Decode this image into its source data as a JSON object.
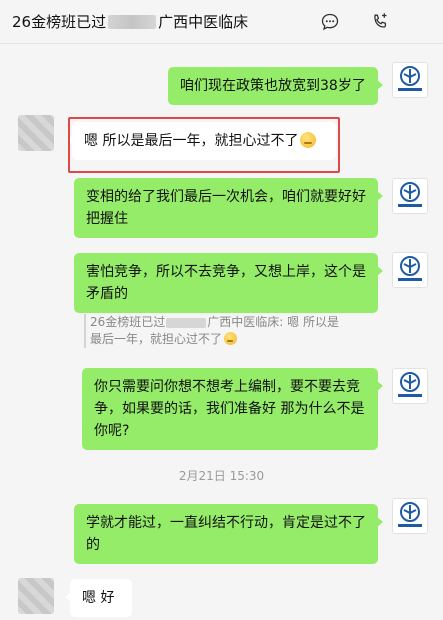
{
  "window": {
    "title_part1": "26金榜班已过",
    "title_part2": "广西中医临床"
  },
  "toolbar": {
    "more_icon": "more-dots-icon",
    "call_icon": "phone-call-icon"
  },
  "logo_text": "中星教育",
  "messages": [
    {
      "side": "out",
      "text": "咱们现在政策也放宽到38岁了"
    },
    {
      "side": "in",
      "text": "嗯    所以是最后一年，就担心过不了",
      "emoji": "worried-face-emoji"
    },
    {
      "side": "out",
      "text": "变相的给了我们最后一次机会，咱们就要好好把握住"
    },
    {
      "side": "out",
      "text": "害怕竞争，所以不去竞争，又想上岸，这个是矛盾的"
    },
    {
      "side": "out",
      "text": "你只需要问你想不想考上编制，要不要去竞争，如果要的话，我们准备好 那为什么不是你呢?"
    },
    {
      "side": "out",
      "text": "学就才能过，一直纠结不行动，肯定是过不了的"
    },
    {
      "side": "in",
      "text": "嗯    好"
    }
  ],
  "quote": {
    "part1": "26金榜班已过",
    "part2": "广西中医临床: 嗯    所以是最后一年，就担心过不了"
  },
  "timestamp": "2月21日 15:30",
  "colors": {
    "outgoing_bubble": "#95ec69",
    "incoming_bubble": "#ffffff",
    "highlight_border": "#e04848",
    "background": "#f5f5f5"
  }
}
